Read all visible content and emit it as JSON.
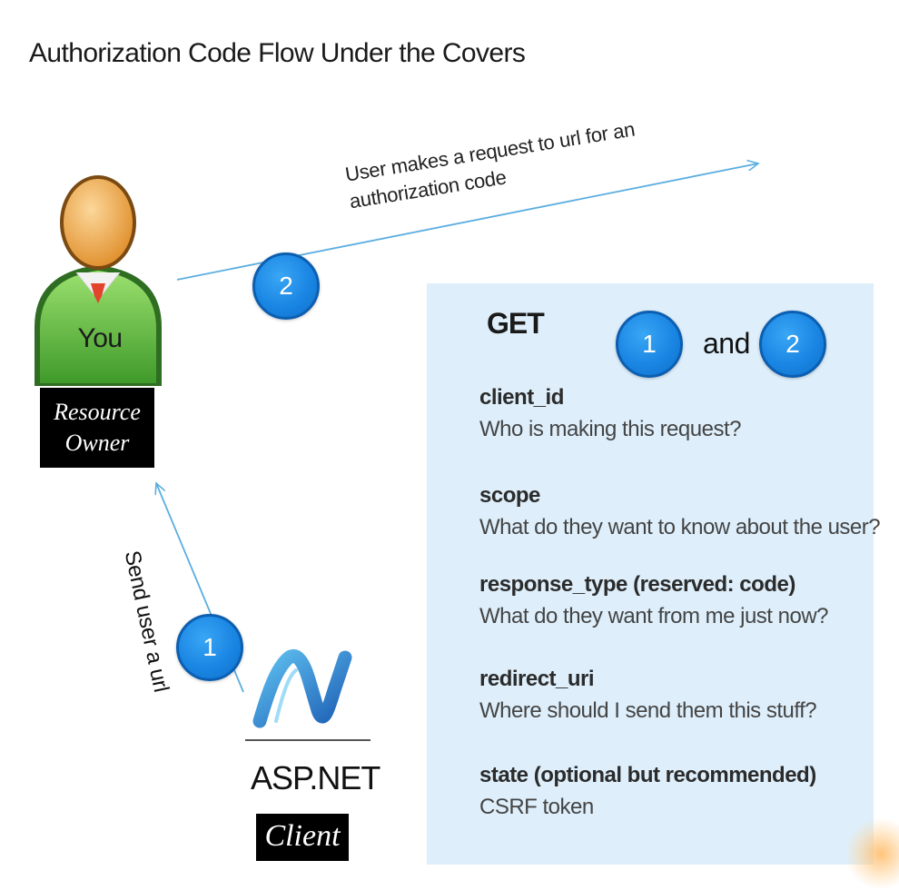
{
  "title": "Authorization Code Flow Under the Covers",
  "arrow_label": {
    "line1": "User makes a request to url for an",
    "line2": "authorization code"
  },
  "send_label": "Send user a url",
  "badges": {
    "one": "1",
    "two": "2"
  },
  "resource_owner": {
    "avatar_label": "You",
    "box_line1": "Resource",
    "box_line2": "Owner"
  },
  "client": {
    "logo_text": "ASP.NET",
    "label": "Client"
  },
  "panel": {
    "method": "GET",
    "and_text": "and",
    "params": [
      {
        "name": "client_id",
        "desc": "Who is making this request?"
      },
      {
        "name": "scope",
        "desc": "What do they want to know about the user?"
      },
      {
        "name": "response_type (reserved: code)",
        "desc": "What do they want from me just now?"
      },
      {
        "name": "redirect_uri",
        "desc": "Where should I send them this stuff?"
      },
      {
        "name": "state (optional but recommended)",
        "desc": "CSRF token"
      }
    ]
  },
  "colors": {
    "badge": "#1a86e3",
    "panel": "#deeffb",
    "arrow": "#5aaee0",
    "avatar_shirt": "#6cbf45",
    "avatar_head": "#f4b15c"
  }
}
